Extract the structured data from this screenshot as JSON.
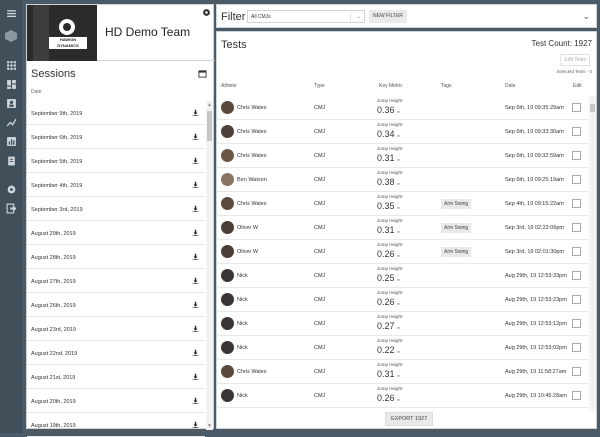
{
  "team": {
    "name": "HD Demo Team",
    "logo_text": "HAWKIN DYNAMICS"
  },
  "sessions": {
    "title": "Sessions",
    "date_header": "Date",
    "items": [
      "September 9th, 2019",
      "September 6th, 2019",
      "September 5th, 2019",
      "September 4th, 2019",
      "September 3rd, 2019",
      "August 29th, 2019",
      "August 28th, 2019",
      "August 27th, 2019",
      "August 26th, 2019",
      "August 23rd, 2019",
      "August 22nd, 2019",
      "August 21st, 2019",
      "August 20th, 2019",
      "August 19th, 2019"
    ]
  },
  "filter": {
    "label": "Filter",
    "selected": "All CMJs",
    "new_filter_label": "NEW FILTER"
  },
  "tests": {
    "title": "Tests",
    "count_label": "Test Count: 1927",
    "edit_label": "Edit Tests",
    "selected_label": "Selected Tests - 0",
    "headers": {
      "athlete": "Athlete",
      "type": "Type",
      "metric": "Key Metric",
      "tags": "Tags",
      "date": "Date",
      "edit": "Edit"
    },
    "rows": [
      {
        "athlete": "Chris Wales",
        "type": "CMJ",
        "metric": "Jump Height",
        "value": "0.36",
        "unit": "m",
        "tag": "",
        "date": "Sep 6th, 19 09:35:29am"
      },
      {
        "athlete": "Chris Wales",
        "type": "CMJ",
        "metric": "Jump Height",
        "value": "0.34",
        "unit": "m",
        "tag": "",
        "date": "Sep 6th, 19 09:33:30am"
      },
      {
        "athlete": "Chris Wales",
        "type": "CMJ",
        "metric": "Jump Height",
        "value": "0.31",
        "unit": "m",
        "tag": "",
        "date": "Sep 6th, 19 09:32:59am"
      },
      {
        "athlete": "Ben Watson",
        "type": "CMJ",
        "metric": "Jump Height",
        "value": "0.38",
        "unit": "m",
        "tag": "",
        "date": "Sep 6th, 19 09:25:19am"
      },
      {
        "athlete": "Chris Wales",
        "type": "CMJ",
        "metric": "Jump Height",
        "value": "0.35",
        "unit": "m",
        "tag": "Arm Swing",
        "date": "Sep 4th, 19 09:15:22am"
      },
      {
        "athlete": "Oliver W",
        "type": "CMJ",
        "metric": "Jump Height",
        "value": "0.31",
        "unit": "m",
        "tag": "Arm Swing",
        "date": "Sep 3rd, 19 02:22:06pm"
      },
      {
        "athlete": "Oliver W",
        "type": "CMJ",
        "metric": "Jump Height",
        "value": "0.26",
        "unit": "m",
        "tag": "Arm Swing",
        "date": "Sep 3rd, 19 02:01:30pm"
      },
      {
        "athlete": "Nick",
        "type": "CMJ",
        "metric": "Jump Height",
        "value": "0.25",
        "unit": "m",
        "tag": "",
        "date": "Aug 29th, 19 12:53:33pm"
      },
      {
        "athlete": "Nick",
        "type": "CMJ",
        "metric": "Jump Height",
        "value": "0.26",
        "unit": "m",
        "tag": "",
        "date": "Aug 29th, 19 12:53:23pm"
      },
      {
        "athlete": "Nick",
        "type": "CMJ",
        "metric": "Jump Height",
        "value": "0.27",
        "unit": "m",
        "tag": "",
        "date": "Aug 29th, 19 12:53:12pm"
      },
      {
        "athlete": "Nick",
        "type": "CMJ",
        "metric": "Jump Height",
        "value": "0.22",
        "unit": "m",
        "tag": "",
        "date": "Aug 29th, 19 12:53:02pm"
      },
      {
        "athlete": "Chris Wales",
        "type": "CMJ",
        "metric": "Jump Height",
        "value": "0.31",
        "unit": "m",
        "tag": "",
        "date": "Aug 29th, 19 11:58:27am"
      },
      {
        "athlete": "Nick",
        "type": "CMJ",
        "metric": "Jump Height",
        "value": "0.26",
        "unit": "m",
        "tag": "",
        "date": "Aug 29th, 19 10:45:28am"
      }
    ],
    "export_label": "EXPORT 1927"
  },
  "nav_icons": [
    "menu-icon",
    "logo-icon",
    "grid-icon",
    "dashboard-icon",
    "user-icon",
    "trend-icon",
    "bar-chart-icon",
    "clipboard-icon",
    "settings-icon",
    "logout-icon"
  ]
}
